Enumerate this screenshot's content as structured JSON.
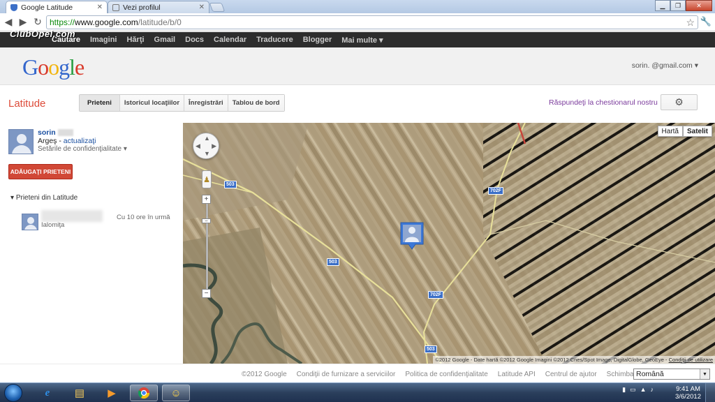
{
  "browser": {
    "tabs": [
      {
        "title": "Google Latitude",
        "active": true
      },
      {
        "title": "Vezi profilul",
        "active": false
      }
    ],
    "url": {
      "scheme": "https://",
      "host": "www.google.com",
      "path": "/latitude/b/0"
    }
  },
  "watermark": "ClubOpel.com",
  "gbar": [
    "Căutare",
    "Imagini",
    "Hărţi",
    "Gmail",
    "Docs",
    "Calendar",
    "Traducere",
    "Blogger",
    "Mai multe ▾"
  ],
  "header": {
    "account": "sorin.     @gmail.com ▾"
  },
  "latitude": {
    "title": "Latitude",
    "tabs": [
      "Prieteni",
      "Istoricul locaţiilor",
      "Înregistrări",
      "Tablou de bord"
    ],
    "survey_link": "Răspundeţi la chestionarul nostru",
    "settings_icon": "gear-icon"
  },
  "me": {
    "name": "sorin",
    "location": "Argeş",
    "update_link": "actualizaţi",
    "privacy": "Setările de confidenţialitate"
  },
  "add_friends_label": "ADĂUGAŢI PRIETENI",
  "friends": {
    "header": "Prieteni din Latitude",
    "items": [
      {
        "location": "Ialomiţa",
        "time": "Cu 10 ore în urmă"
      }
    ]
  },
  "map": {
    "type_buttons": [
      "Hartă",
      "Satelit"
    ],
    "selected_type": "Satelit",
    "road_labels": [
      "503",
      "503",
      "503",
      "702F",
      "702F"
    ],
    "copyright": "©2012 Google - Date hartă ©2012 Google Imagini ©2012 Cnes/Spot Image, DigitalGlobe, GeoEye - ",
    "terms_link": "Condiţii de utilizare"
  },
  "footer": {
    "links": [
      "©2012 Google",
      "Condiţii de furnizare a serviciilor",
      "Politica de confidenţialitate",
      "Latitude API",
      "Centrul de ajutor",
      "Schimbaţi limba:"
    ],
    "language": "Română"
  },
  "taskbar": {
    "time": "9:41 AM",
    "date": "3/6/2012"
  }
}
